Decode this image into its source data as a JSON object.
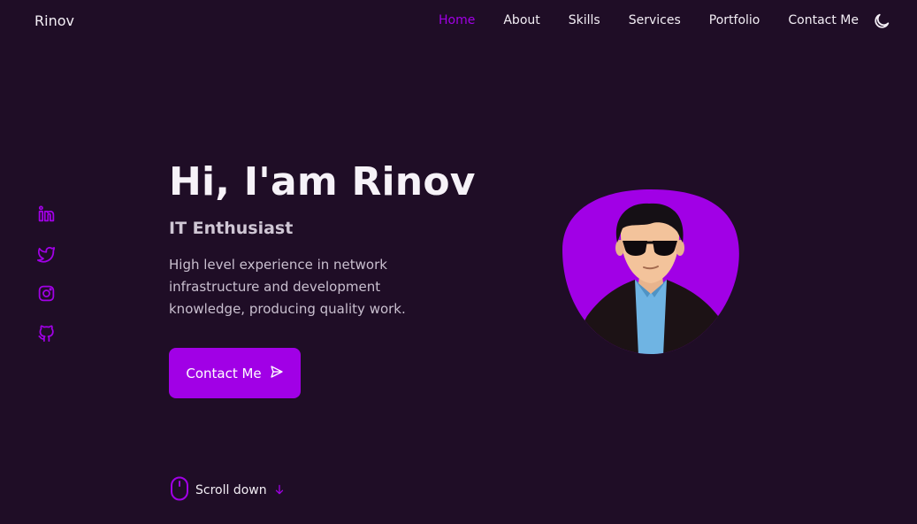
{
  "header": {
    "logo": "Rinov",
    "nav": [
      {
        "label": "Home",
        "active": true
      },
      {
        "label": "About",
        "active": false
      },
      {
        "label": "Skills",
        "active": false
      },
      {
        "label": "Services",
        "active": false
      },
      {
        "label": "Portfolio",
        "active": false
      },
      {
        "label": "Contact Me",
        "active": false
      }
    ],
    "theme_icon": "moon-icon"
  },
  "socials": [
    "linkedin-icon",
    "twitter-icon",
    "instagram-icon",
    "github-icon"
  ],
  "hero": {
    "title": "Hi, I'am Rinov",
    "subtitle": "IT Enthusiast",
    "description": "High level experience in network infrastructure and development knowledge, producing quality work.",
    "cta_label": "Contact Me",
    "cta_icon": "send-icon"
  },
  "scroll": {
    "label": "Scroll down",
    "mouse_icon": "mouse-icon",
    "arrow_icon": "arrow-down-icon"
  },
  "colors": {
    "background": "#1f0d26",
    "accent": "#a100e6",
    "text": "#f3eef5"
  }
}
